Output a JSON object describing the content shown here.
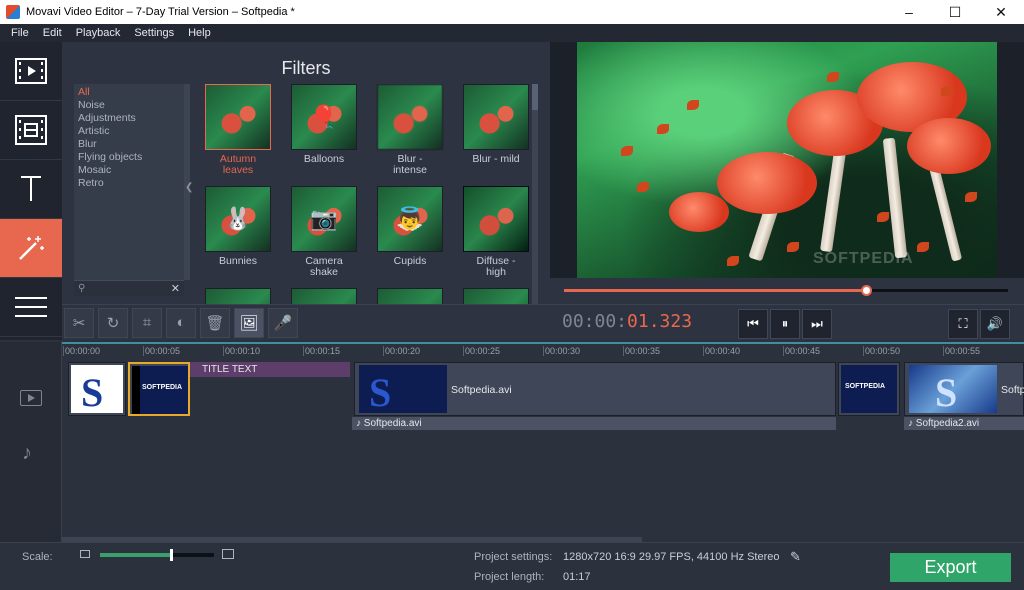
{
  "window": {
    "title": "Movavi Video Editor – 7-Day Trial Version – Softpedia *",
    "controls": [
      "–",
      "☐",
      "✕"
    ]
  },
  "menu": [
    "File",
    "Edit",
    "Playback",
    "Settings",
    "Help"
  ],
  "tools": [
    {
      "icon": "film-import-icon",
      "active": false
    },
    {
      "icon": "film-transitions-icon",
      "active": false
    },
    {
      "icon": "text-icon",
      "active": false
    },
    {
      "icon": "magic-wand-icon",
      "active": true
    },
    {
      "icon": "menu-icon",
      "active": false
    }
  ],
  "filters": {
    "title": "Filters",
    "categories": [
      "All",
      "Noise",
      "Adjustments",
      "Artistic",
      "Blur",
      "Flying objects",
      "Mosaic",
      "Retro"
    ],
    "active_category": "All",
    "search_icon": "search-icon",
    "clear_label": "✕",
    "collapse_label": "❮",
    "items": [
      {
        "label": "Autumn\nleaves",
        "badge": "",
        "selected": true
      },
      {
        "label": "Balloons",
        "badge": "🎈",
        "selected": false
      },
      {
        "label": "Blur -\nintense",
        "badge": "",
        "selected": false
      },
      {
        "label": "Blur - mild",
        "badge": "",
        "selected": false
      },
      {
        "label": "Bunnies",
        "badge": "🐰",
        "selected": false
      },
      {
        "label": "Camera\nshake",
        "badge": "📷",
        "selected": false
      },
      {
        "label": "Cupids",
        "badge": "👼",
        "selected": false
      },
      {
        "label": "Diffuse -\nhigh",
        "badge": "",
        "selected": false
      }
    ]
  },
  "edit_tools": [
    {
      "name": "cut-tool",
      "glyph": "✂",
      "on": false
    },
    {
      "name": "rotate-tool",
      "glyph": "↻",
      "on": false
    },
    {
      "name": "crop-tool",
      "glyph": "⌗",
      "on": false
    },
    {
      "name": "color-adjust-tool",
      "glyph": "◐",
      "on": false
    },
    {
      "name": "delete-tool",
      "glyph": "🗑",
      "on": false
    },
    {
      "name": "image-tool",
      "glyph": "🖼",
      "on": true
    },
    {
      "name": "mic-tool",
      "glyph": "🎤",
      "on": false
    }
  ],
  "preview": {
    "watermark": "SOFTPEDIA",
    "seek_progress": 0.68
  },
  "transport": {
    "time_dim": "00:00:",
    "time_live": "01.323",
    "prev_label": "⏮",
    "pause_label": "⏸",
    "next_label": "⏭",
    "fullscreen_label": "⛶",
    "volume_label": "🔊"
  },
  "timeline": {
    "ruler": [
      "00:00:00",
      "00:00:05",
      "00:00:10",
      "00:00:15",
      "00:00:20",
      "00:00:25",
      "00:00:30",
      "00:00:35",
      "00:00:40",
      "00:00:45",
      "00:00:50",
      "00:00:55"
    ],
    "title_clip": "TITLE TEXT",
    "video_clip_1": "Softpedia.avi",
    "video_clip_2": "Softpedia.avi",
    "video_clip_3": "Softp",
    "audio_clip_1": "♪  Softpedia.avi",
    "audio_clip_2": "♪  Softpedia2.avi",
    "thumb_text": "SOFTPEDIA"
  },
  "status": {
    "scale_label": "Scale:",
    "scale_value": 0.62,
    "project_settings_key": "Project settings:",
    "project_settings_val": "1280x720 16:9 29.97 FPS, 44100 Hz Stereo",
    "project_length_key": "Project length:",
    "project_length_val": "01:17",
    "edit_icon": "pencil-icon",
    "export_label": "Export"
  },
  "colors": {
    "accent": "#e8684f",
    "export": "#2fa56a",
    "selection": "#e8a92a"
  }
}
